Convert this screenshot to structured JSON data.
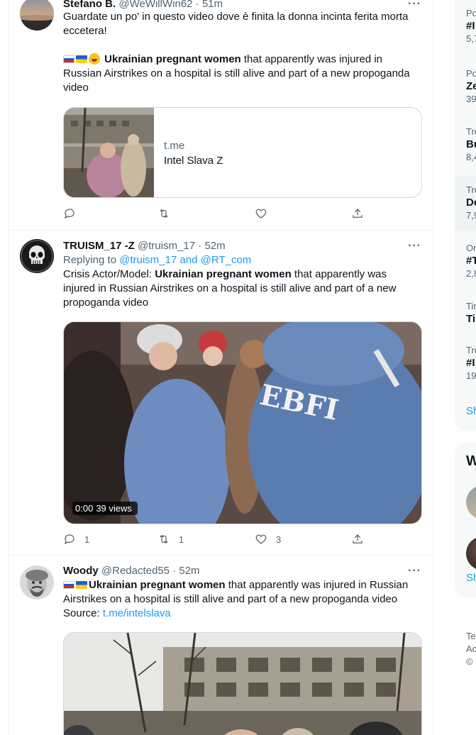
{
  "tweets": [
    {
      "name": "Stefano B.",
      "handle": "@WeWillWin62",
      "time": "51m",
      "more": "···",
      "text1": "Guardate un po' in questo video dove è finita la donna incinta ferita morta eccetera!",
      "text2_bold": "Ukrainian pregnant women",
      "text2_rest": " that apparently was injured in Russian Airstrikes on a hospital is still alive and part of a new propoganda video",
      "card": {
        "domain": "t.me",
        "title": "Intel Slava Z"
      },
      "counts": {
        "reply": "",
        "retweet": "",
        "like": ""
      }
    },
    {
      "name": "TRUISM_17 -Z",
      "handle": "@truism_17",
      "time": "52m",
      "more": "···",
      "replying_prefix": "Replying to ",
      "replying_to": "@truism_17 and @RT_com",
      "text_pre": "Crisis Actor/Model: ",
      "text_bold": "Ukrainian pregnant women",
      "text_rest": " that apparently was injured in Russian Airstrikes on a hospital is still alive and part of a new propoganda video",
      "video": {
        "duration": "0:00",
        "views": "39 views",
        "logo_text": "EBFI"
      },
      "counts": {
        "reply": "1",
        "retweet": "1",
        "like": "3"
      }
    },
    {
      "name": "Woody",
      "handle": "@Redacted55",
      "time": "52m",
      "more": "···",
      "text_bold": "Ukrainian pregnant women",
      "text_rest": " that apparently was injured in Russian Airstrikes on a hospital is still alive and part of a new propoganda video",
      "source_label": "Source: ",
      "source_link": "t.me/intelslava"
    }
  ],
  "sidebar": {
    "trends": [
      {
        "ctx": "Po",
        "title": "#I",
        "count": "5,7"
      },
      {
        "ctx": "Po",
        "title": "Ze",
        "count": "39"
      },
      {
        "ctx": "Tre",
        "title": "Bu",
        "count": "8,4"
      },
      {
        "ctx": "Tre",
        "title": "De",
        "count": "7,9"
      },
      {
        "ctx": "On",
        "title": "#T",
        "count": "2,8"
      },
      {
        "ctx": "Tir",
        "title": "Tir",
        "count": ""
      },
      {
        "ctx": "Tre",
        "title": "#I",
        "count": "19"
      }
    ],
    "show_more": "Sh",
    "who_title": "W",
    "who_show_more": "Sh",
    "footer": [
      "Te",
      "Ac",
      "©"
    ]
  },
  "colors": {
    "accent": "#1d9bf0",
    "text_secondary": "#536471",
    "border": "#cfd9de"
  }
}
